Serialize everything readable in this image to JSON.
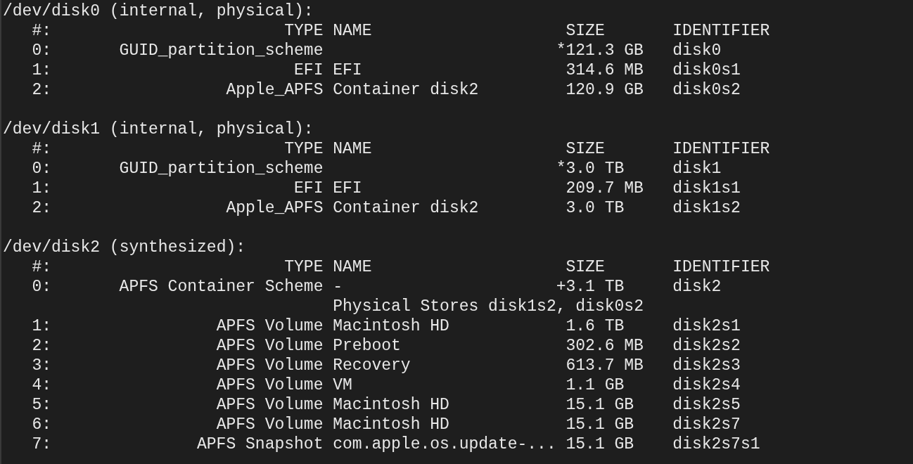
{
  "disks": [
    {
      "title": "/dev/disk0 (internal, physical):",
      "columns": {
        "index": "#:",
        "type": "TYPE",
        "name": "NAME",
        "size": "SIZE",
        "identifier": "IDENTIFIER"
      },
      "rows": [
        {
          "kind": "partition",
          "index": "0:",
          "type": "GUID_partition_scheme",
          "name": "",
          "size_mark": "*",
          "size": "121.3 GB",
          "identifier": "disk0"
        },
        {
          "kind": "partition",
          "index": "1:",
          "type": "EFI",
          "name": "EFI",
          "size": "314.6 MB",
          "identifier": "disk0s1"
        },
        {
          "kind": "partition",
          "index": "2:",
          "type": "Apple_APFS",
          "name": "Container disk2",
          "size": "120.9 GB",
          "identifier": "disk0s2"
        }
      ]
    },
    {
      "title": "/dev/disk1 (internal, physical):",
      "columns": {
        "index": "#:",
        "type": "TYPE",
        "name": "NAME",
        "size": "SIZE",
        "identifier": "IDENTIFIER"
      },
      "rows": [
        {
          "kind": "partition",
          "index": "0:",
          "type": "GUID_partition_scheme",
          "name": "",
          "size_mark": "*",
          "size": "3.0 TB",
          "identifier": "disk1"
        },
        {
          "kind": "partition",
          "index": "1:",
          "type": "EFI",
          "name": "EFI",
          "size": "209.7 MB",
          "identifier": "disk1s1"
        },
        {
          "kind": "partition",
          "index": "2:",
          "type": "Apple_APFS",
          "name": "Container disk2",
          "size": "3.0 TB",
          "identifier": "disk1s2"
        }
      ]
    },
    {
      "title": "/dev/disk2 (synthesized):",
      "columns": {
        "index": "#:",
        "type": "TYPE",
        "name": "NAME",
        "size": "SIZE",
        "identifier": "IDENTIFIER"
      },
      "rows": [
        {
          "kind": "partition",
          "index": "0:",
          "type": "APFS Container Scheme",
          "name": "-",
          "size_mark": "+",
          "size": "3.1 TB",
          "identifier": "disk2"
        },
        {
          "kind": "note",
          "text": "Physical Stores disk1s2, disk0s2"
        },
        {
          "kind": "partition",
          "index": "1:",
          "type": "APFS Volume",
          "name": "Macintosh HD",
          "size": "1.6 TB",
          "identifier": "disk2s1"
        },
        {
          "kind": "partition",
          "index": "2:",
          "type": "APFS Volume",
          "name": "Preboot",
          "size": "302.6 MB",
          "identifier": "disk2s2"
        },
        {
          "kind": "partition",
          "index": "3:",
          "type": "APFS Volume",
          "name": "Recovery",
          "size": "613.7 MB",
          "identifier": "disk2s3"
        },
        {
          "kind": "partition",
          "index": "4:",
          "type": "APFS Volume",
          "name": "VM",
          "size": "1.1 GB",
          "identifier": "disk2s4"
        },
        {
          "kind": "partition",
          "index": "5:",
          "type": "APFS Volume",
          "name": "Macintosh HD",
          "size": "15.1 GB",
          "identifier": "disk2s5"
        },
        {
          "kind": "partition",
          "index": "6:",
          "type": "APFS Volume",
          "name": "Macintosh HD",
          "size": "15.1 GB",
          "identifier": "disk2s7"
        },
        {
          "kind": "partition",
          "index": "7:",
          "type": "APFS Snapshot",
          "name": "com.apple.os.update-...",
          "size": "15.1 GB",
          "identifier": "disk2s7s1"
        }
      ]
    }
  ]
}
